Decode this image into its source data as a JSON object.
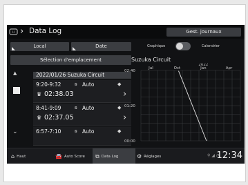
{
  "header": {
    "title": "Data Log",
    "gestion_button": "Gest. journaux",
    "logo_icon": "honda-logo-icon"
  },
  "filters": {
    "local_label": "Local",
    "date_label": "Date",
    "graph_label": "Graphique",
    "calendar_label": "Calendrier",
    "view_toggle_state": "graphique"
  },
  "left_panel": {
    "select_location": "Sélection d'emplacement",
    "date_header": "2022/01/26  Suzuka Circuit",
    "sessions": [
      {
        "time": "9:20-9:32",
        "mode": "Auto",
        "lap": "02:38.03"
      },
      {
        "time": "8:41-9:09",
        "mode": "Auto",
        "lap": "02:37.05"
      },
      {
        "time": "6:57-7:10",
        "mode": "Auto",
        "lap": ""
      }
    ]
  },
  "chart_data": {
    "type": "line",
    "title": "Suzuka Circuit",
    "x_ticks": [
      "Jul",
      "Oct",
      "2022 Jan",
      "Apr"
    ],
    "y_ticks": [
      "02:40",
      "01:20",
      "00:00"
    ],
    "ylim_seconds": [
      0,
      160
    ],
    "series": [
      {
        "points": [
          {
            "x": "2021-10-20",
            "y_seconds": 159
          },
          {
            "x": "2022-01-26",
            "y_seconds": 0
          }
        ]
      }
    ],
    "grid": true,
    "line_color": "#d8d8d8"
  },
  "nav": {
    "items": [
      {
        "label": "Haut",
        "icon": "home-icon"
      },
      {
        "label": "Auto Score",
        "icon": "car-icon"
      },
      {
        "label": "Data Log",
        "icon": "data-log-icon"
      },
      {
        "label": "Réglages",
        "icon": "gear-icon"
      }
    ],
    "clock": "12:34"
  },
  "colors": {
    "background": "#111214",
    "button": "#3b3d41",
    "accent": "#ececec"
  }
}
